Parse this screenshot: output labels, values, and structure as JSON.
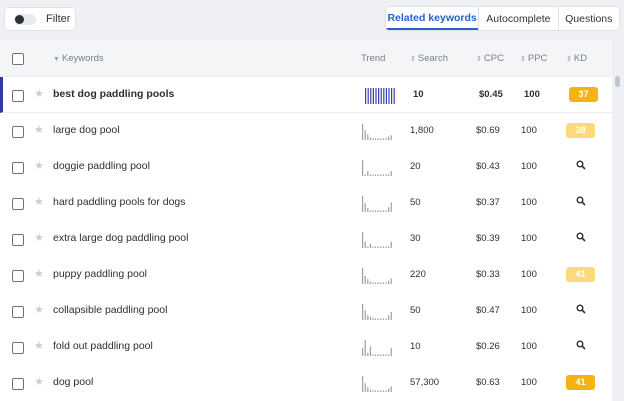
{
  "filter": {
    "label": "Filter"
  },
  "tabs": [
    {
      "label": "Related keywords",
      "active": true
    },
    {
      "label": "Autocomplete",
      "active": false
    },
    {
      "label": "Questions",
      "active": false
    }
  ],
  "columns": {
    "keywords": "Keywords",
    "trend": "Trend",
    "search": "Search",
    "cpc": "CPC",
    "ppc": "PPC",
    "kd": "KD"
  },
  "colors": {
    "accent": "#2563c9",
    "kd_orange": "#f6b212",
    "kd_light": "#fbd97c",
    "trend_selected": "#3a3fb0",
    "trend": "#9a9ea5"
  },
  "rows": [
    {
      "keyword": "best dog paddling pools",
      "search": "10",
      "cpc": "$0.45",
      "ppc": "100",
      "kd": "37",
      "kd_level": "high",
      "selected": true,
      "trend": [
        1,
        1,
        1,
        1,
        1,
        1,
        1,
        1,
        1,
        1,
        1,
        1
      ]
    },
    {
      "keyword": "large dog pool",
      "search": "1,800",
      "cpc": "$0.69",
      "ppc": "100",
      "kd": "38",
      "kd_level": "light",
      "trend": [
        1,
        0.6,
        0.35,
        0.15,
        0.12,
        0.1,
        0.1,
        0.1,
        0.1,
        0.12,
        0.2,
        0.3
      ]
    },
    {
      "keyword": "doggie paddling pool",
      "search": "20",
      "cpc": "$0.43",
      "ppc": "100",
      "kd": "",
      "kd_level": "none",
      "trend": [
        1,
        0.1,
        0.3,
        0.1,
        0.1,
        0.1,
        0.1,
        0.1,
        0.1,
        0.1,
        0.1,
        0.3
      ]
    },
    {
      "keyword": "hard paddling pools for dogs",
      "search": "50",
      "cpc": "$0.37",
      "ppc": "100",
      "kd": "",
      "kd_level": "none",
      "trend": [
        1,
        0.55,
        0.25,
        0.1,
        0.1,
        0.1,
        0.1,
        0.1,
        0.1,
        0.1,
        0.3,
        0.6
      ]
    },
    {
      "keyword": "extra large dog paddling pool",
      "search": "30",
      "cpc": "$0.39",
      "ppc": "100",
      "kd": "",
      "kd_level": "none",
      "trend": [
        1,
        0.4,
        0.1,
        0.25,
        0.1,
        0.1,
        0.1,
        0.1,
        0.1,
        0.1,
        0.1,
        0.4
      ]
    },
    {
      "keyword": "puppy paddling pool",
      "search": "220",
      "cpc": "$0.33",
      "ppc": "100",
      "kd": "41",
      "kd_level": "light",
      "trend": [
        1,
        0.5,
        0.3,
        0.15,
        0.1,
        0.1,
        0.1,
        0.1,
        0.1,
        0.1,
        0.2,
        0.35
      ]
    },
    {
      "keyword": "collapsible paddling pool",
      "search": "50",
      "cpc": "$0.47",
      "ppc": "100",
      "kd": "",
      "kd_level": "none",
      "trend": [
        1,
        0.6,
        0.3,
        0.2,
        0.15,
        0.1,
        0.1,
        0.1,
        0.1,
        0.1,
        0.3,
        0.5
      ]
    },
    {
      "keyword": "fold out paddling pool",
      "search": "10",
      "cpc": "$0.26",
      "ppc": "100",
      "kd": "",
      "kd_level": "none",
      "trend": [
        0.5,
        1,
        0.2,
        0.6,
        0.1,
        0.1,
        0.1,
        0.1,
        0.1,
        0.1,
        0.1,
        0.5
      ]
    },
    {
      "keyword": "dog pool",
      "search": "57,300",
      "cpc": "$0.63",
      "ppc": "100",
      "kd": "41",
      "kd_level": "high",
      "trend": [
        1,
        0.55,
        0.3,
        0.15,
        0.1,
        0.1,
        0.1,
        0.1,
        0.1,
        0.1,
        0.2,
        0.35
      ]
    }
  ]
}
